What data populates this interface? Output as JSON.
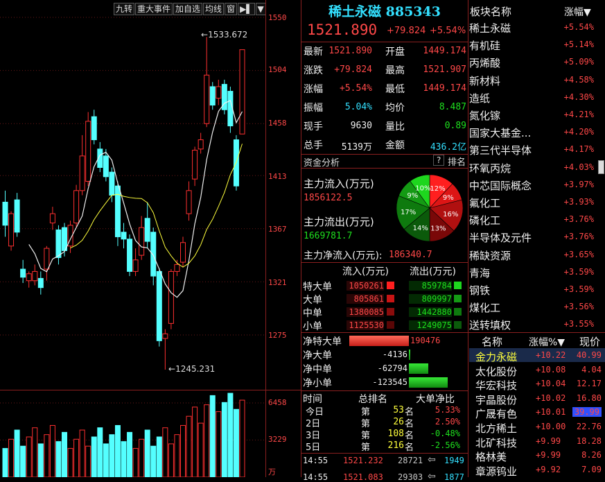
{
  "toolbar": {
    "items": [
      "九转",
      "重大事件",
      "加自选",
      "均线",
      "窗",
      "▶▌",
      "▼"
    ]
  },
  "price_axis": {
    "ticks": [
      "1550",
      "1504",
      "1458",
      "1413",
      "1367",
      "1321",
      "1275"
    ]
  },
  "chart_labels": {
    "high": "1533.672",
    "low": "1245.231"
  },
  "volume_axis": {
    "ticks": [
      "6458",
      "3229"
    ],
    "unit": "万"
  },
  "header": {
    "name": "稀土永磁",
    "code": "885343",
    "price": "1521.890",
    "change": "+79.824",
    "change_pct": "+5.54%"
  },
  "quote": [
    {
      "l1": "最新",
      "v1": "1521.890",
      "l2": "开盘",
      "v2": "1449.174"
    },
    {
      "l1": "涨跌",
      "v1": "+79.824",
      "l2": "最高",
      "v2": "1521.907"
    },
    {
      "l1": "涨幅",
      "v1": "+5.54%",
      "l2": "最低",
      "v2": "1449.174"
    },
    {
      "l1": "振幅",
      "v1": "5.04%",
      "l2": "均价",
      "v2": "8.487"
    },
    {
      "l1": "现手",
      "v1": "9630",
      "l2": "量比",
      "v2": "0.89"
    },
    {
      "l1": "总手",
      "v1": "5139万",
      "l2": "金额",
      "v2": "436.2亿"
    }
  ],
  "fund": {
    "title": "资金分析",
    "help": "?",
    "rank": "排名",
    "inflow_label": "主力流入(万元)",
    "inflow": "1856122.5",
    "outflow_label": "主力流出(万元)",
    "outflow": "1669781.7",
    "net_label": "主力净流入(万元):",
    "net": "186340.7"
  },
  "pie": {
    "slices": [
      {
        "label": "12%",
        "value": 12,
        "color": "#ff1f1f"
      },
      {
        "label": "9%",
        "value": 9,
        "color": "#dd1515"
      },
      {
        "label": "16%",
        "value": 16,
        "color": "#b01010"
      },
      {
        "label": "13%",
        "value": 13,
        "color": "#7a0808"
      },
      {
        "label": "14%",
        "value": 14,
        "color": "#0b5a0b"
      },
      {
        "label": "17%",
        "value": 17,
        "color": "#0e7a0e"
      },
      {
        "label": "9%",
        "value": 9,
        "color": "#149a14"
      },
      {
        "label": "10%",
        "value": 10,
        "color": "#1ed61e"
      }
    ]
  },
  "flow_table": {
    "h_in": "流入(万元)",
    "h_out": "流出(万元)",
    "rows": [
      {
        "label": "特大单",
        "in": "1050261",
        "out": "859784"
      },
      {
        "label": "大单",
        "in": "805861",
        "out": "809997"
      },
      {
        "label": "中单",
        "in": "1380085",
        "out": "1442880"
      },
      {
        "label": "小单",
        "in": "1125530",
        "out": "1249075"
      }
    ]
  },
  "net_table": {
    "rows": [
      {
        "label": "净特大单",
        "value": "190476",
        "num": 190476
      },
      {
        "label": "净大单",
        "value": "-4136",
        "num": -4136
      },
      {
        "label": "净中单",
        "value": "-62794",
        "num": -62794
      },
      {
        "label": "净小单",
        "value": "-123545",
        "num": -123545
      }
    ]
  },
  "rank_table": {
    "h_time": "时间",
    "h_rank": "总排名",
    "h_net": "大单净比",
    "rows": [
      {
        "t": "今日",
        "pre": "第",
        "n": "53",
        "suf": "名",
        "pct": "5.33%"
      },
      {
        "t": "2日",
        "pre": "第",
        "n": "26",
        "suf": "名",
        "pct": "2.50%"
      },
      {
        "t": "3日",
        "pre": "第",
        "n": "108",
        "suf": "名",
        "pct": "-0.48%"
      },
      {
        "t": "5日",
        "pre": "第",
        "n": "216",
        "suf": "名",
        "pct": "-2.56%"
      }
    ]
  },
  "ticks_list": [
    {
      "time": "14:55",
      "price": "1521.232",
      "vol": "28721",
      "arrow": "⇦",
      "num": "1949"
    },
    {
      "time": "14:55",
      "price": "1521.083",
      "vol": "29303",
      "arrow": "⇦",
      "num": "1877"
    }
  ],
  "sectors": {
    "h_name": "板块名称",
    "h_pct": "涨幅▼",
    "rows": [
      {
        "name": "稀土永磁",
        "pct": "+5.54%"
      },
      {
        "name": "有机硅",
        "pct": "+5.14%"
      },
      {
        "name": "丙烯酸",
        "pct": "+5.09%"
      },
      {
        "name": "新材料",
        "pct": "+4.58%"
      },
      {
        "name": "造纸",
        "pct": "+4.30%"
      },
      {
        "name": "氮化镓",
        "pct": "+4.21%"
      },
      {
        "name": "国家大基金...",
        "pct": "+4.20%"
      },
      {
        "name": "第三代半导体",
        "pct": "+4.17%"
      },
      {
        "name": "环氧丙烷",
        "pct": "+4.03%"
      },
      {
        "name": "中芯国际概念",
        "pct": "+3.97%"
      },
      {
        "name": "氟化工",
        "pct": "+3.93%"
      },
      {
        "name": "磷化工",
        "pct": "+3.76%"
      },
      {
        "name": "半导体及元件",
        "pct": "+3.76%"
      },
      {
        "name": "稀缺资源",
        "pct": "+3.65%"
      },
      {
        "name": "青海",
        "pct": "+3.59%"
      },
      {
        "name": "钢铁",
        "pct": "+3.59%"
      },
      {
        "name": "煤化工",
        "pct": "+3.56%"
      },
      {
        "name": "送转填权",
        "pct": "+3.55%"
      }
    ]
  },
  "stocks": {
    "h_name": "名称",
    "h_pct": "涨幅%▼",
    "h_price": "现价",
    "rows": [
      {
        "name": "金力永磁",
        "pct": "+10.22",
        "price": "40.99",
        "sel": true
      },
      {
        "name": "太化股份",
        "pct": "+10.08",
        "price": "4.04"
      },
      {
        "name": "华宏科技",
        "pct": "+10.04",
        "price": "12.17"
      },
      {
        "name": "宇晶股份",
        "pct": "+10.02",
        "price": "16.80"
      },
      {
        "name": "广晟有色",
        "pct": "+10.01",
        "price": "39.99",
        "hl": true
      },
      {
        "name": "北方稀土",
        "pct": "+10.00",
        "price": "22.76"
      },
      {
        "name": "北矿科技",
        "pct": "+9.99",
        "price": "18.28"
      },
      {
        "name": "格林美",
        "pct": "+9.99",
        "price": "8.26"
      },
      {
        "name": "章源钨业",
        "pct": "+9.92",
        "price": "7.09"
      }
    ]
  }
}
